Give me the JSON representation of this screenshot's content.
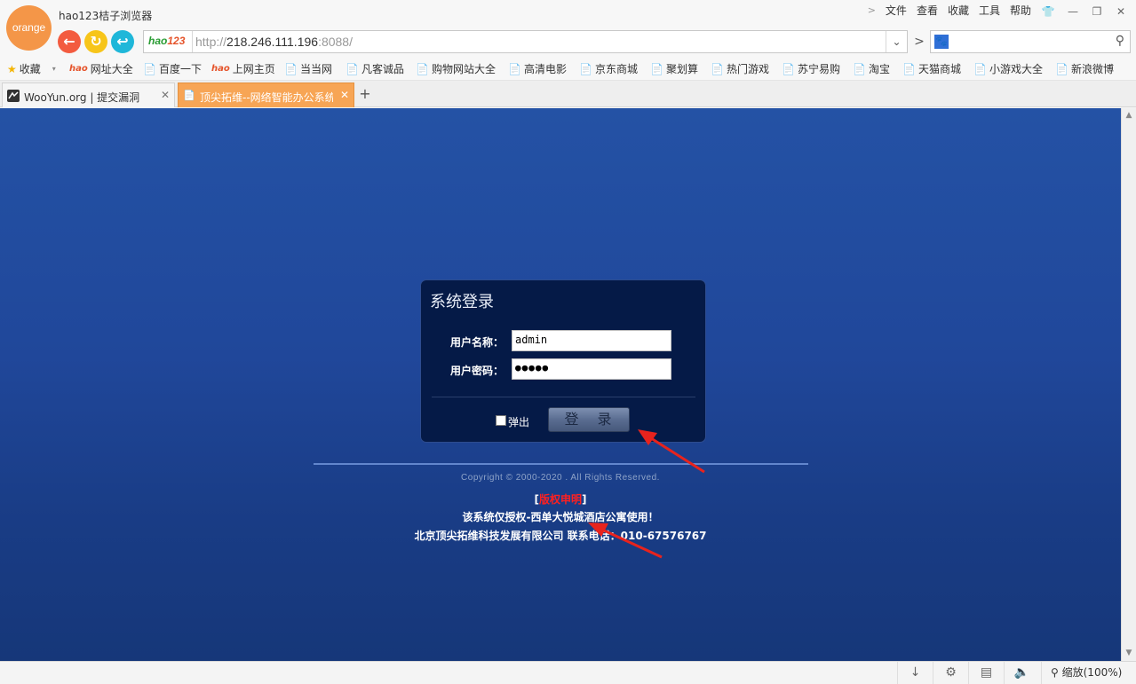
{
  "browser": {
    "logo_text": "orange",
    "title": "hao123桔子浏览器",
    "menu": [
      "文件",
      "查看",
      "收藏",
      "工具",
      "帮助"
    ],
    "address": {
      "logo_text": "hao123",
      "scheme": "http://",
      "host": "218.246.111.196",
      "port_path": ":8088/"
    },
    "bookmarks": [
      "收藏",
      "网址大全",
      "百度一下",
      "上网主页",
      "当当网",
      "凡客诚品",
      "购物网站大全",
      "高清电影",
      "京东商城",
      "聚划算",
      "热门游戏",
      "苏宁易购",
      "淘宝",
      "天猫商城",
      "小游戏大全",
      "新浪微博"
    ],
    "tabs": [
      {
        "title": "WooYun.org | 提交漏洞"
      },
      {
        "title": "顶尖拓维--网络智能办公系统"
      }
    ],
    "status": {
      "zoom": "缩放(100%)"
    }
  },
  "login": {
    "title": "系统登录",
    "username_label": "用户名称：",
    "username_value": "admin",
    "password_label": "用户密码：",
    "password_value": "●●●●●",
    "popup_label": "弹出",
    "submit_label": "登 录"
  },
  "footer": {
    "copyright": "Copyright © 2000-2020 . All Rights Reserved.",
    "notice_open": "[",
    "notice_text": "版权申明",
    "notice_close": "]",
    "auth_text": "该系统仅授权-西单大悦城酒店公寓使用！",
    "company_text": "北京顶尖拓维科技发展有限公司  联系电话：010-67576767"
  },
  "colors": {
    "accent": "#f49648",
    "page_bg": "#2452a5",
    "login_panel": "#051a47",
    "arrow": "#e8231d",
    "notice_red": "#ff2020"
  }
}
